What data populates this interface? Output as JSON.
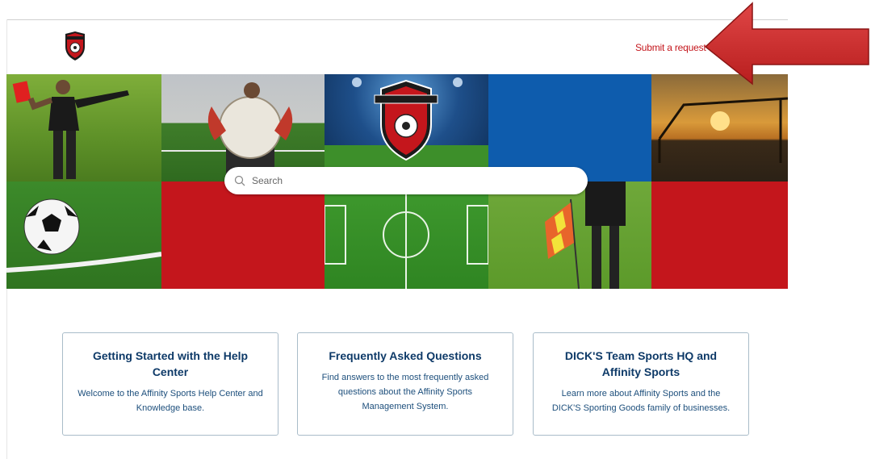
{
  "header": {
    "submit_label": "Submit a request"
  },
  "search": {
    "placeholder": "Search"
  },
  "cards": [
    {
      "title": "Getting Started with the Help Center",
      "desc": "Welcome to the Affinity Sports Help Center and Knowledge base."
    },
    {
      "title": "Frequently Asked Questions",
      "desc": "Find answers to the most frequently asked questions about the Affinity Sports Management System."
    },
    {
      "title": "DICK'S Team Sports HQ and Affinity Sports",
      "desc": "Learn more about Affinity Sports and the DICK'S Sporting Goods family of businesses."
    }
  ],
  "colors": {
    "brand_red": "#c4161c",
    "brand_blue": "#0e5cad",
    "card_title": "#0e3a68",
    "card_border": "#a9bcc9"
  },
  "icons": {
    "logo": "soccer-shield-logo",
    "search": "search-icon",
    "annotation": "red-arrow"
  }
}
